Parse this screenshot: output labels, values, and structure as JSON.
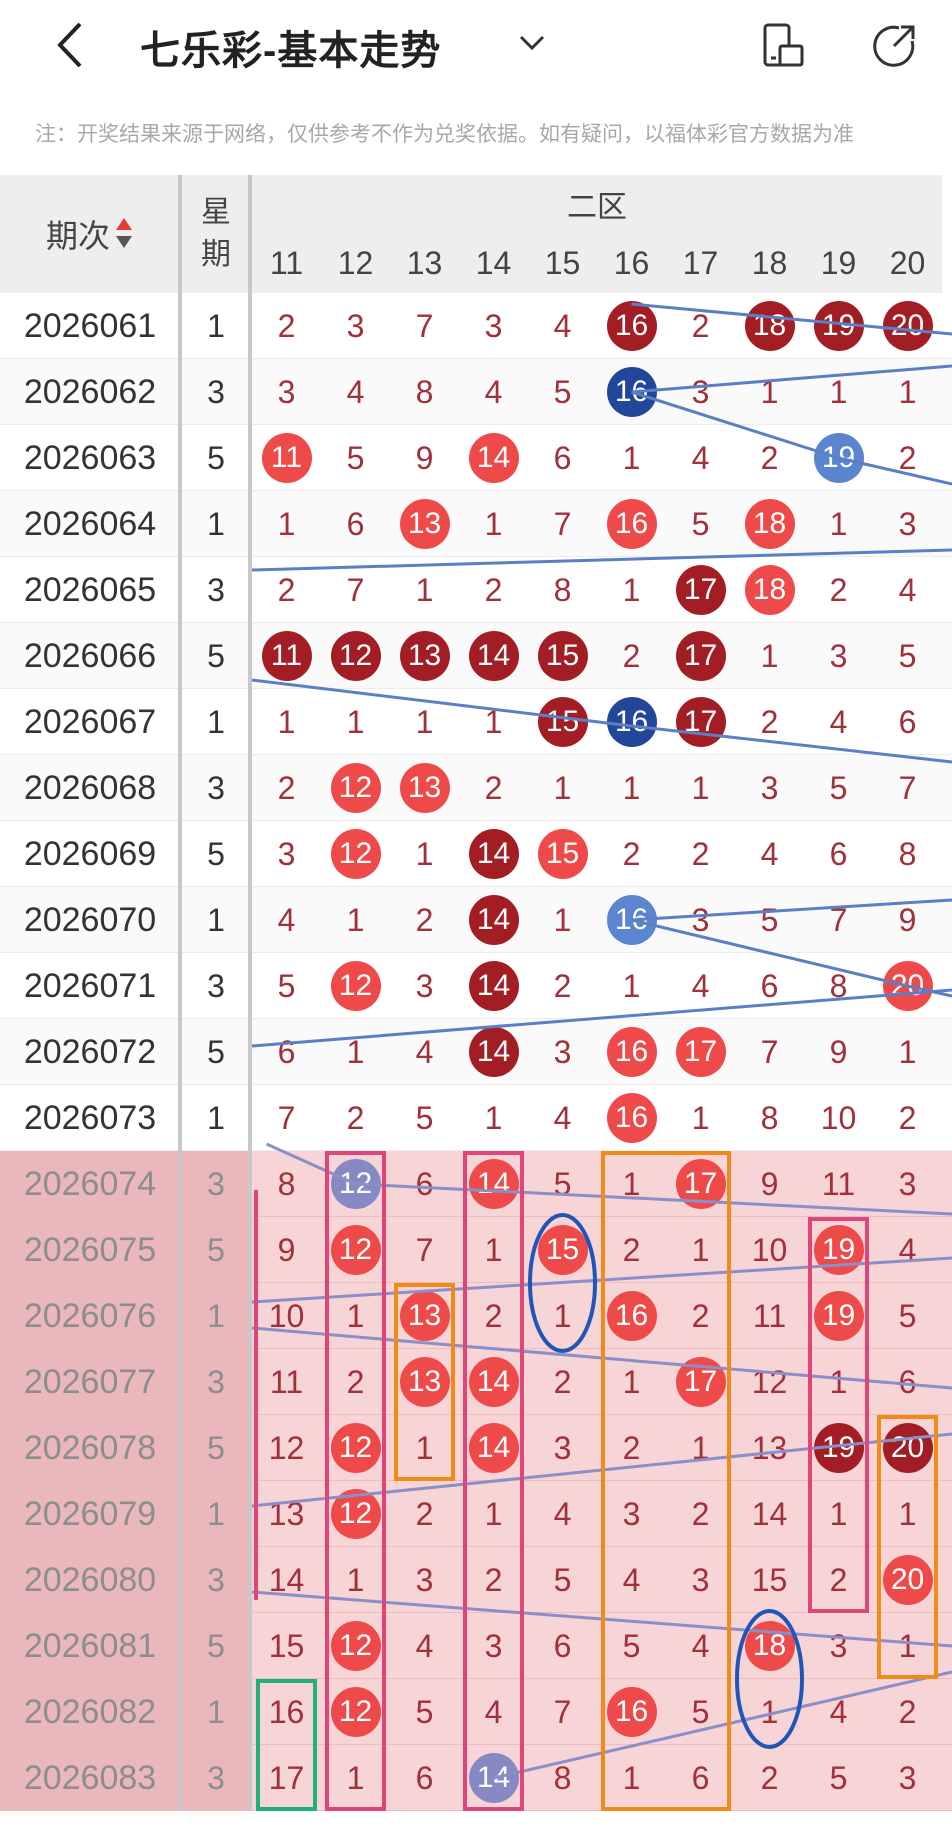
{
  "header": {
    "title": "七乐彩-基本走势",
    "back_icon": "chevron-left-icon",
    "dropdown_icon": "chevron-down-icon",
    "icons": [
      "screen-mode-icon",
      "share-icon"
    ]
  },
  "notice": "注：开奖结果来源于网络，仅供参考不作为兑奖依据。如有疑问，以福体彩官方数据为准",
  "table": {
    "period_header": "期次",
    "weekday_header": "星期",
    "zone_header": "二区",
    "columns": [
      "11",
      "12",
      "13",
      "14",
      "15",
      "16",
      "17",
      "18",
      "19",
      "20"
    ],
    "rows": [
      {
        "period": "2026061",
        "weekday": "1",
        "cells": [
          "2",
          "3",
          "7",
          "3",
          "4",
          "16",
          "2",
          "18",
          "19",
          "20"
        ]
      },
      {
        "period": "2026062",
        "weekday": "3",
        "cells": [
          "3",
          "4",
          "8",
          "4",
          "5",
          "16",
          "3",
          "1",
          "1",
          "1"
        ]
      },
      {
        "period": "2026063",
        "weekday": "5",
        "cells": [
          "11",
          "5",
          "9",
          "14",
          "6",
          "1",
          "4",
          "2",
          "19",
          "2"
        ]
      },
      {
        "period": "2026064",
        "weekday": "1",
        "cells": [
          "1",
          "6",
          "13",
          "1",
          "7",
          "16",
          "5",
          "18",
          "1",
          "3"
        ]
      },
      {
        "period": "2026065",
        "weekday": "3",
        "cells": [
          "2",
          "7",
          "1",
          "2",
          "8",
          "1",
          "17",
          "18",
          "2",
          "4"
        ]
      },
      {
        "period": "2026066",
        "weekday": "5",
        "cells": [
          "11",
          "12",
          "13",
          "14",
          "15",
          "2",
          "17",
          "1",
          "3",
          "5"
        ]
      },
      {
        "period": "2026067",
        "weekday": "1",
        "cells": [
          "1",
          "1",
          "1",
          "1",
          "15",
          "16",
          "17",
          "2",
          "4",
          "6"
        ]
      },
      {
        "period": "2026068",
        "weekday": "3",
        "cells": [
          "2",
          "12",
          "13",
          "2",
          "1",
          "1",
          "1",
          "3",
          "5",
          "7"
        ]
      },
      {
        "period": "2026069",
        "weekday": "5",
        "cells": [
          "3",
          "12",
          "1",
          "14",
          "15",
          "2",
          "2",
          "4",
          "6",
          "8"
        ]
      },
      {
        "period": "2026070",
        "weekday": "1",
        "cells": [
          "4",
          "1",
          "2",
          "14",
          "1",
          "16",
          "3",
          "5",
          "7",
          "9"
        ]
      },
      {
        "period": "2026071",
        "weekday": "3",
        "cells": [
          "5",
          "12",
          "3",
          "14",
          "2",
          "1",
          "4",
          "6",
          "8",
          "20"
        ]
      },
      {
        "period": "2026072",
        "weekday": "5",
        "cells": [
          "6",
          "1",
          "4",
          "14",
          "3",
          "16",
          "17",
          "7",
          "9",
          "1"
        ]
      },
      {
        "period": "2026073",
        "weekday": "1",
        "cells": [
          "7",
          "2",
          "5",
          "1",
          "4",
          "16",
          "1",
          "8",
          "10",
          "2"
        ]
      },
      {
        "period": "2026074",
        "weekday": "3",
        "cells": [
          "8",
          "12",
          "6",
          "14",
          "5",
          "1",
          "17",
          "9",
          "11",
          "3"
        ]
      },
      {
        "period": "2026075",
        "weekday": "5",
        "cells": [
          "9",
          "12",
          "7",
          "1",
          "15",
          "2",
          "1",
          "10",
          "19",
          "4"
        ]
      },
      {
        "period": "2026076",
        "weekday": "1",
        "cells": [
          "10",
          "1",
          "13",
          "2",
          "1",
          "16",
          "2",
          "11",
          "19",
          "5"
        ]
      },
      {
        "period": "2026077",
        "weekday": "3",
        "cells": [
          "11",
          "2",
          "13",
          "14",
          "2",
          "1",
          "17",
          "12",
          "1",
          "6"
        ]
      },
      {
        "period": "2026078",
        "weekday": "5",
        "cells": [
          "12",
          "12",
          "1",
          "14",
          "3",
          "2",
          "1",
          "13",
          "19",
          "20"
        ]
      },
      {
        "period": "2026079",
        "weekday": "1",
        "cells": [
          "13",
          "12",
          "2",
          "1",
          "4",
          "3",
          "2",
          "14",
          "1",
          "1"
        ]
      },
      {
        "period": "2026080",
        "weekday": "3",
        "cells": [
          "14",
          "1",
          "3",
          "2",
          "5",
          "4",
          "3",
          "15",
          "2",
          "20"
        ]
      },
      {
        "period": "2026081",
        "weekday": "5",
        "cells": [
          "15",
          "12",
          "4",
          "3",
          "6",
          "5",
          "4",
          "18",
          "3",
          "1"
        ]
      },
      {
        "period": "2026082",
        "weekday": "1",
        "cells": [
          "16",
          "12",
          "5",
          "4",
          "7",
          "16",
          "5",
          "1",
          "4",
          "2"
        ]
      },
      {
        "period": "2026083",
        "weekday": "3",
        "cells": [
          "17",
          "1",
          "6",
          "14",
          "8",
          "1",
          "6",
          "2",
          "5",
          "3"
        ]
      }
    ],
    "balls": [
      [
        null,
        null,
        null,
        null,
        null,
        "dark",
        null,
        "dark",
        "dark",
        "dark"
      ],
      [
        null,
        null,
        null,
        null,
        null,
        "navy",
        null,
        null,
        null,
        null
      ],
      [
        "red",
        null,
        null,
        "red",
        null,
        null,
        null,
        null,
        "lblue",
        null
      ],
      [
        null,
        null,
        "red",
        null,
        null,
        "red",
        null,
        "red",
        null,
        null
      ],
      [
        null,
        null,
        null,
        null,
        null,
        null,
        "dark",
        "red",
        null,
        null
      ],
      [
        "dark",
        "dark",
        "dark",
        "dark",
        "dark",
        null,
        "dark",
        null,
        null,
        null
      ],
      [
        null,
        null,
        null,
        null,
        "dark",
        "navy",
        "dark",
        null,
        null,
        null
      ],
      [
        null,
        "red",
        "red",
        null,
        null,
        null,
        null,
        null,
        null,
        null
      ],
      [
        null,
        "red",
        null,
        "dark",
        "red",
        null,
        null,
        null,
        null,
        null
      ],
      [
        null,
        null,
        null,
        "dark",
        null,
        "lblue",
        null,
        null,
        null,
        null
      ],
      [
        null,
        "red",
        null,
        "dark",
        null,
        null,
        null,
        null,
        null,
        "red"
      ],
      [
        null,
        null,
        null,
        "dark",
        null,
        "red",
        "red",
        null,
        null,
        null
      ],
      [
        null,
        null,
        null,
        null,
        null,
        "red",
        null,
        null,
        null,
        null
      ],
      [
        null,
        "grey",
        null,
        "red",
        null,
        null,
        "red",
        null,
        null,
        null
      ],
      [
        null,
        "red",
        null,
        null,
        "red",
        null,
        null,
        null,
        "red",
        null
      ],
      [
        null,
        null,
        "red",
        null,
        null,
        "red",
        null,
        null,
        "red",
        null
      ],
      [
        null,
        null,
        "red",
        "red",
        null,
        null,
        "red",
        null,
        null,
        null
      ],
      [
        null,
        "red",
        null,
        "red",
        null,
        null,
        null,
        null,
        "dark",
        "dark"
      ],
      [
        null,
        "red",
        null,
        null,
        null,
        null,
        null,
        null,
        null,
        null
      ],
      [
        null,
        null,
        null,
        null,
        null,
        null,
        null,
        null,
        null,
        "red"
      ],
      [
        null,
        "red",
        null,
        null,
        null,
        null,
        null,
        "red",
        null,
        null
      ],
      [
        null,
        "red",
        null,
        null,
        null,
        "red",
        null,
        null,
        null,
        null
      ],
      [
        null,
        null,
        null,
        "grey",
        null,
        null,
        null,
        null,
        null,
        null
      ]
    ]
  },
  "colors": {
    "header_bg": "#eeeeee",
    "number_text": "#a0303a",
    "highlight_rows": "#f7d4d6",
    "ball_dark": "#a31e24",
    "ball_red": "#ef4a4a",
    "ball_navy": "#22479a",
    "ball_light_blue": "#5b86cf",
    "line_blue": "#5a7fc4"
  }
}
